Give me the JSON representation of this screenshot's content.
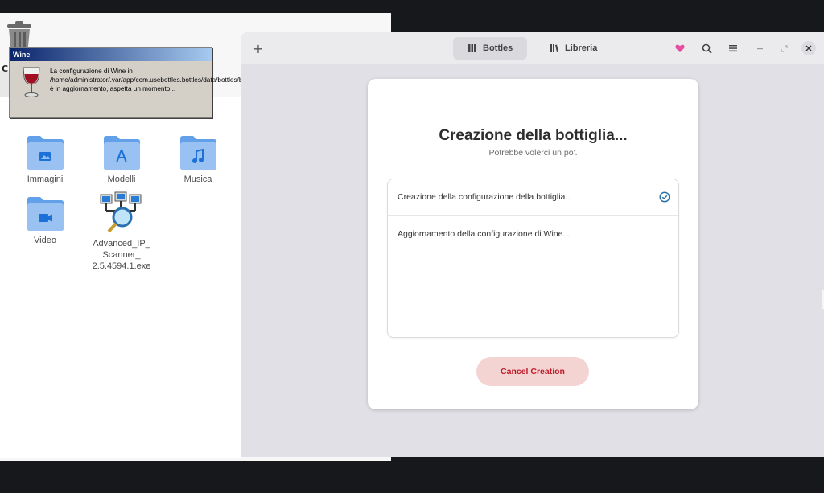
{
  "desktop": {
    "trash_label": "C",
    "files": [
      {
        "label": "Immagini",
        "icon": "image-folder-icon"
      },
      {
        "label": "Modelli",
        "icon": "templates-folder-icon"
      },
      {
        "label": "Musica",
        "icon": "music-folder-icon"
      },
      {
        "label": "Video",
        "icon": "video-folder-icon"
      },
      {
        "label": "Advanced_IP_\nScanner_\n2.5.4594.1.exe",
        "icon": "exe-file-icon"
      }
    ]
  },
  "wine_dialog": {
    "title": "Wine",
    "message": "La configurazione di Wine in /home/administrator/.var/app/com.usebottles.bottles/data/bottles/bottles/ipscanner è in aggiornamento, aspetta un momento..."
  },
  "bottles": {
    "tabs": [
      {
        "label": "Bottles",
        "active": true
      },
      {
        "label": "Libreria",
        "active": false
      }
    ],
    "dialog": {
      "title": "Creazione della bottiglia...",
      "subtitle": "Potrebbe volerci un po'.",
      "steps": [
        {
          "label": "Creazione della configurazione della bottiglia...",
          "done": true
        },
        {
          "label": "Aggiornamento della configurazione di Wine...",
          "done": false
        }
      ],
      "cancel_label": "Cancel Creation"
    },
    "colors": {
      "accent_blue": "#1c71d8",
      "destructive": "#c01c28",
      "heart": "#e64ca0"
    }
  }
}
